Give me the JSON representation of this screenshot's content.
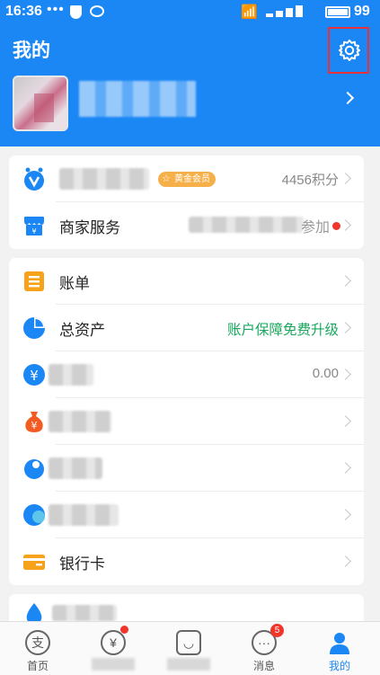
{
  "status_bar": {
    "time": "16:36",
    "dots": "•••",
    "battery_level": "99"
  },
  "header": {
    "title": "我的",
    "settings_icon": "gear-icon",
    "highlight_color": "#e8313a",
    "bg_color": "#1a87f5"
  },
  "card1": {
    "rows": [
      {
        "icon": "member-icon",
        "badge": "黄金会员",
        "right": "4456积分"
      },
      {
        "label": "商家服务",
        "right": "参加",
        "icon": "shop-icon"
      }
    ]
  },
  "card2": {
    "rows": [
      {
        "label": "账单",
        "icon": "bill-icon",
        "color": "#f7a21b"
      },
      {
        "label": "总资产",
        "right": "账户保障免费升级",
        "right_color": "#19a85e",
        "icon": "pie-chart-icon"
      },
      {
        "right": "0.00",
        "icon": "yen-icon"
      },
      {
        "icon": "money-bag-icon"
      },
      {
        "icon": "water-drop-icon"
      },
      {
        "icon": "circle-icon"
      },
      {
        "label": "银行卡",
        "icon": "bank-card-icon"
      }
    ]
  },
  "nav": {
    "tabs": [
      {
        "label": "首页",
        "icon": "alipay-icon"
      },
      {
        "icon": "yen-circle-icon"
      },
      {
        "icon": "friends-icon"
      },
      {
        "label": "消息",
        "icon": "chat-icon",
        "badge": "5"
      },
      {
        "label": "我的",
        "icon": "person-icon",
        "active": true
      }
    ]
  }
}
